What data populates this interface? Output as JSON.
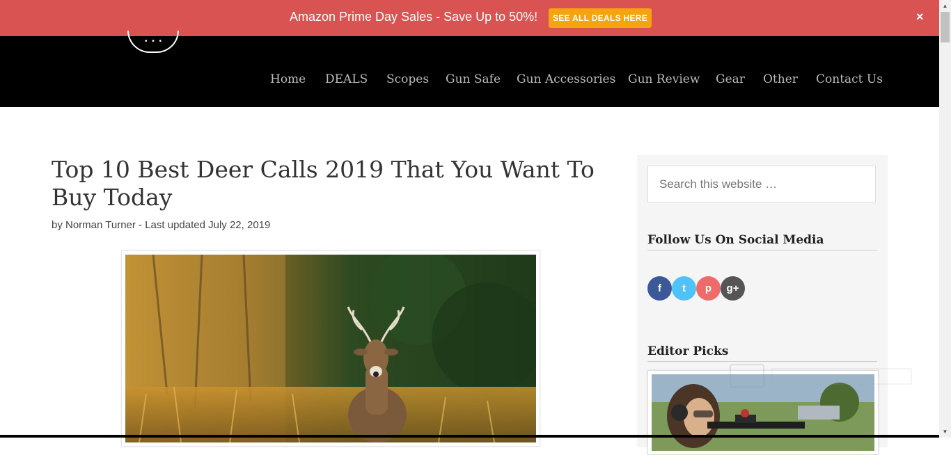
{
  "promo": {
    "text": "Amazon Prime Day Sales - Save Up to 50%!",
    "button": "SEE ALL DEALS HERE",
    "close": "×",
    "bg_color": "#d95353",
    "button_color": "#f5a40f"
  },
  "logo": {
    "dots": "• • •"
  },
  "nav": {
    "items": [
      "Home",
      "DEALS",
      "Scopes",
      "Gun Safe",
      "Gun Accessories",
      "Gun Review",
      "Gear",
      "Other",
      "Contact Us"
    ]
  },
  "article": {
    "title": "Top 10 Best Deer Calls 2019 That You Want To Buy Today",
    "byline": "by Norman Turner - Last updated July 22, 2019",
    "hero_image": "whitetail deer buck in forest clearing"
  },
  "sidebar": {
    "search_placeholder": "Search this website …",
    "follow_title": "Follow Us On Social Media",
    "social": [
      {
        "name": "facebook-icon",
        "glyph": "f",
        "color": "#3b5998"
      },
      {
        "name": "twitter-icon",
        "glyph": "t",
        "color": "#4fc3f7"
      },
      {
        "name": "pinterest-icon",
        "glyph": "p",
        "color": "#ef6b6b"
      },
      {
        "name": "google-plus-icon",
        "glyph": "g+",
        "color": "#555555"
      }
    ],
    "editor_title": "Editor Picks",
    "pick_image": "woman aiming rifle with ear protection"
  },
  "scrollbar": {
    "up": "▲",
    "down": "▼"
  }
}
